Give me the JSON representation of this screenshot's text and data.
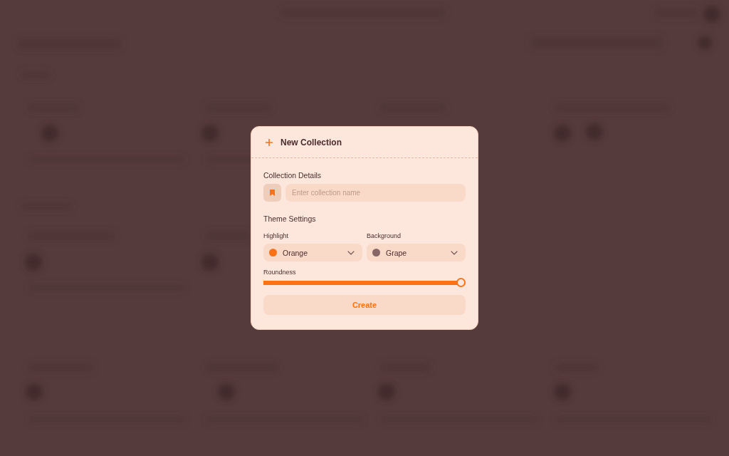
{
  "dialog": {
    "title": "New Collection",
    "details": {
      "heading": "Collection Details",
      "name_field": {
        "placeholder": "Enter collection name"
      }
    },
    "theme": {
      "heading": "Theme Settings",
      "selects": [
        {
          "label": "Highlight",
          "value": "Orange",
          "color": "#f97316"
        },
        {
          "label": "Background",
          "value": "Grape",
          "color": "#876666"
        }
      ],
      "slider": {
        "label": "Roundness",
        "level": 1
      }
    },
    "create_button": "Create"
  }
}
